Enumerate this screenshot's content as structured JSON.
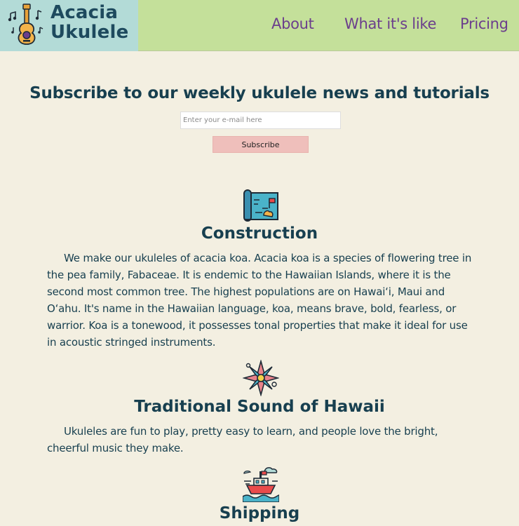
{
  "header": {
    "brand": {
      "line1": "Acacia",
      "line2": "Ukulele",
      "icon": "ukulele-logo-icon"
    },
    "nav": [
      {
        "label": "About"
      },
      {
        "label": "What it's like"
      },
      {
        "label": "Pricing"
      }
    ]
  },
  "subscribe": {
    "heading": "Subscribe to our weekly ukulele news and tutorials",
    "placeholder": "Enter your e-mail here",
    "button_label": "Subscribe"
  },
  "sections": [
    {
      "icon": "map-icon",
      "title": "Construction",
      "text": "We make our ukuleles of acacia koa. Acacia koa is a species of flowering tree in the pea family, Fabaceae. It is endemic to the Hawaiian Islands, where it is the second most common tree. The highest populations are on Hawaiʻi, Maui and Oʻahu. It's name in the Hawaiian language, koa, means brave, bold, fearless, or warrior. Koa is a tonewood, it possesses tonal properties that make it ideal for use in acoustic stringed instruments."
    },
    {
      "icon": "flower-icon",
      "title": "Traditional Sound of Hawaii",
      "text": "Ukuleles are fun to play, pretty easy to learn, and people love the bright, cheerful music they make."
    },
    {
      "icon": "ship-icon",
      "title": "Shipping"
    }
  ]
}
